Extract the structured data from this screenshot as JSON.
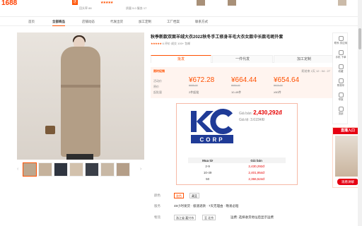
{
  "topbar": {
    "logo": "1688",
    "shop_badge": "店",
    "shop_meta": "回头率 88",
    "shop_meta2": "质量 5.0  服务 17",
    "stars": "★★★★★"
  },
  "nav": {
    "items": [
      "首页",
      "全部商品",
      "店铺动态",
      "代发出货",
      "加工定制",
      "工厂档案",
      "联系方式"
    ],
    "active_index": 1
  },
  "product": {
    "title": "秋季新款双面羊绒大衣2022秋冬手工修身羊毛大衣女款中长款毛呢外套",
    "stars": "★★★★★",
    "rating_text": "6  评价  成交 100+  包邮",
    "tabs": [
      "批发",
      "一件代发",
      "加工定制"
    ],
    "active_tab": 0
  },
  "pricing": {
    "promo": "限时促销",
    "countdown": "距结束 2天 12 : 04 : 27",
    "labels": [
      "活动价",
      "原价",
      "起批量"
    ],
    "tiers": [
      {
        "price": "¥672.28",
        "old": "¥688.00",
        "qty": "2件起批"
      },
      {
        "price": "¥664.44",
        "old": "¥680.00",
        "qty": "10-49件"
      },
      {
        "price": "¥654.64",
        "old": "¥670.00",
        "qty": "≥50件"
      }
    ]
  },
  "overlay": {
    "logo_text": "CORP",
    "gia_ban_label": "Giá bán:",
    "gia_ban_value": "2,430,292đ",
    "gia_te_label": "Giá tệ:",
    "gia_te_value": "3.615¥/Đ",
    "table_headers": [
      "Mua từ",
      "Giá bán"
    ],
    "rows": [
      {
        "qty": "2-9",
        "price": "2,430,292đ"
      },
      {
        "qty": "10-49",
        "price": "2,401,954đ"
      },
      {
        "qty": "50",
        "price": "2,366,524đ"
      }
    ]
  },
  "options": {
    "color_label": "颜色",
    "colors": [
      "驼色",
      "藏蓝"
    ],
    "service_label": "服务",
    "service_value": "48小时发货  · 极速退款 · 7天无理由 · 晚发必赔",
    "ship_label": "物流",
    "ship_from": "浙江省 嘉兴市",
    "ship_to": "至 北京",
    "ship_fee": "运费: 选择收货地址后显示运费"
  },
  "sidebar": {
    "items": [
      "联系\n供应商",
      "手机\n下单",
      "收藏",
      "购物车",
      "举报",
      "顶部"
    ]
  },
  "live": {
    "header": "直播入口",
    "button": "观看讲解"
  },
  "colors": {
    "accent": "#ff5000",
    "price_red": "#e60000",
    "kc_blue": "#1f3b97"
  }
}
